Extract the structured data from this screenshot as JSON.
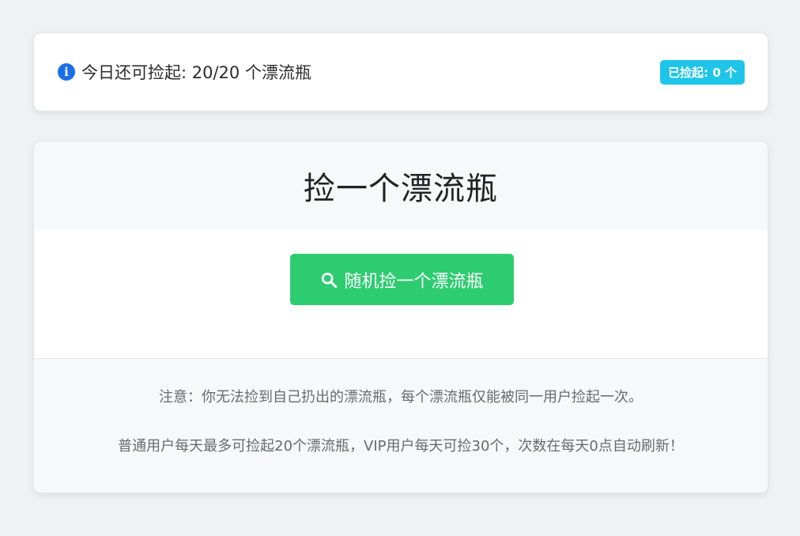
{
  "status": {
    "remaining_text": "今日还可捡起: 20/20 个漂流瓶",
    "picked_badge": "已捡起: 0 个",
    "info_icon": "info-circle-icon"
  },
  "main": {
    "title": "捡一个漂流瓶",
    "button_label": "随机捡一个漂流瓶",
    "button_icon": "search-icon",
    "button_color": "#2ecc71"
  },
  "notes": {
    "line1": "注意：你无法捡到自己扔出的漂流瓶，每个漂流瓶仅能被同一用户捡起一次。",
    "line2": "普通用户每天最多可捡起20个漂流瓶，VIP用户每天可捡30个，次数在每天0点自动刷新！"
  },
  "colors": {
    "info_blue": "#1a6fe8",
    "badge_cyan": "#1ec5e8",
    "page_bg": "#f0f1f3"
  }
}
